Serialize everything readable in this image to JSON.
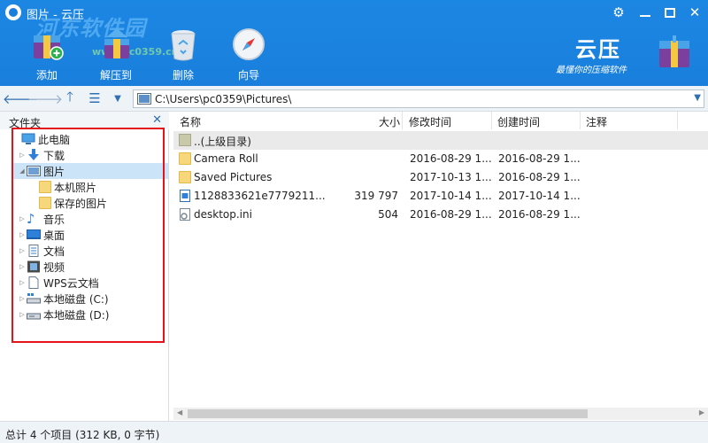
{
  "window": {
    "title": "图片 - 云压",
    "watermark": "河东软件园",
    "watermark_url": "www.pc0359.cn"
  },
  "toolbar": {
    "items": [
      {
        "label": "添加",
        "icon": "add-icon"
      },
      {
        "label": "解压到",
        "icon": "extract-icon"
      },
      {
        "label": "删除",
        "icon": "delete-icon"
      },
      {
        "label": "向导",
        "icon": "wizard-icon"
      }
    ]
  },
  "brand": {
    "name": "云压",
    "slogan": "最懂你的压缩软件"
  },
  "address": {
    "path": "C:\\Users\\pc0359\\Pictures\\"
  },
  "sidebar": {
    "title": "文件夹",
    "items": [
      {
        "label": "此电脑",
        "icon": "computer-icon",
        "expandable": false,
        "level": 0
      },
      {
        "label": "下载",
        "icon": "download-icon",
        "expandable": true,
        "level": 1
      },
      {
        "label": "图片",
        "icon": "pictures-icon",
        "expandable": true,
        "level": 1,
        "expanded": true,
        "selected": true
      },
      {
        "label": "本机照片",
        "icon": "folder-icon",
        "expandable": false,
        "level": 2
      },
      {
        "label": "保存的图片",
        "icon": "folder-icon",
        "expandable": false,
        "level": 2
      },
      {
        "label": "音乐",
        "icon": "music-icon",
        "expandable": true,
        "level": 1
      },
      {
        "label": "桌面",
        "icon": "desktop-icon",
        "expandable": true,
        "level": 1
      },
      {
        "label": "文档",
        "icon": "documents-icon",
        "expandable": true,
        "level": 1
      },
      {
        "label": "视频",
        "icon": "video-icon",
        "expandable": true,
        "level": 1
      },
      {
        "label": "WPS云文档",
        "icon": "cloud-doc-icon",
        "expandable": true,
        "level": 1
      },
      {
        "label": "本地磁盘 (C:)",
        "icon": "disk-icon",
        "expandable": true,
        "level": 1
      },
      {
        "label": "本地磁盘 (D:)",
        "icon": "disk-icon",
        "expandable": true,
        "level": 1
      }
    ]
  },
  "filelist": {
    "columns": [
      "名称",
      "大小",
      "修改时间",
      "创建时间",
      "注释"
    ],
    "rows": [
      {
        "name": "..(上级目录)",
        "size": "",
        "modified": "",
        "created": "",
        "icon": "parent-folder-icon"
      },
      {
        "name": "Camera Roll",
        "size": "",
        "modified": "2016-08-29 1...",
        "created": "2016-08-29 1...",
        "icon": "folder-icon"
      },
      {
        "name": "Saved Pictures",
        "size": "",
        "modified": "2017-10-13 1...",
        "created": "2016-08-29 1...",
        "icon": "folder-icon"
      },
      {
        "name": "1128833621e7779211...",
        "size": "319 797",
        "modified": "2017-10-14 1...",
        "created": "2017-10-14 1...",
        "icon": "image-file-icon"
      },
      {
        "name": "desktop.ini",
        "size": "504",
        "modified": "2016-08-29 1...",
        "created": "2016-08-29 1...",
        "icon": "settings-file-icon"
      }
    ]
  },
  "status": {
    "text": "总计 4 个项目 (312 KB, 0 字节)"
  }
}
